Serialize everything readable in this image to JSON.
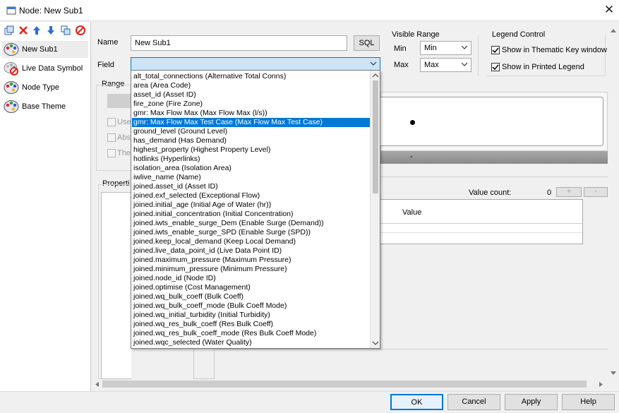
{
  "window": {
    "title": "Node: New Sub1"
  },
  "left_pane": {
    "items": [
      {
        "label": "New Sub1"
      },
      {
        "label": "Live Data Symbol"
      },
      {
        "label": "Node Type"
      },
      {
        "label": "Base Theme"
      }
    ]
  },
  "form": {
    "name_label": "Name",
    "name_value": "New Sub1",
    "sql_label": "SQL",
    "field_label": "Field",
    "range_label": "Range",
    "use_label": "Use",
    "abs_label": "Abs",
    "the_label": "Ther",
    "properties_label": "Properti"
  },
  "visible_range": {
    "title": "Visible Range",
    "min_label": "Min",
    "min_value": "Min",
    "max_label": "Max",
    "max_value": "Max"
  },
  "legend_control": {
    "title": "Legend Control",
    "thematic_label": "Show in Thematic Key window",
    "printed_label": "Show in Printed Legend"
  },
  "values_panel": {
    "preview_dash": "-",
    "value_count_label": "Value count:",
    "value_count": "0",
    "plus": "+",
    "minus": "-",
    "value_header": "Value"
  },
  "field_dropdown": {
    "items": [
      "alt_total_connections (Alternative Total Conns)",
      "area (Area Code)",
      "asset_id (Asset ID)",
      "fire_zone (Fire Zone)",
      "gmr: Max Flow Max (Max Flow Max (l/s))",
      "gmr: Max Flow Max Test Case (Max Flow Max Test Case)",
      "ground_level (Ground Level)",
      "has_demand (Has Demand)",
      "highest_property (Highest Property Level)",
      "hotlinks (Hyperlinks)",
      "isolation_area (Isolation Area)",
      "iwlive_name (Name)",
      "joined.asset_id (Asset ID)",
      "joined.exf_selected (Exceptional Flow)",
      "joined.initial_age (Initial Age of Water (hr))",
      "joined.initial_concentration (Initial  Concentration)",
      "joined.iwts_enable_surge_Dem (Enable Surge (Demand))",
      "joined.iwts_enable_surge_SPD (Enable Surge (SPD))",
      "joined.keep_local_demand (Keep Local Demand)",
      "joined.live_data_point_id (Live Data Point ID)",
      "joined.maximum_pressure (Maximum Pressure)",
      "joined.minimum_pressure (Minimum Pressure)",
      "joined.node_id (Node ID)",
      "joined.optimise (Cost Management)",
      "joined.wq_bulk_coeff (Bulk Coeff)",
      "joined.wq_bulk_coeff_mode (Bulk Coeff Mode)",
      "joined.wq_initial_turbidity (Initial  Turbidity)",
      "joined.wq_res_bulk_coeff (Res Bulk Coeff)",
      "joined.wq_res_bulk_coeff_mode (Res Bulk Coeff Mode)",
      "joined.wqc_selected (Water Quality)"
    ],
    "selected_index": 5
  },
  "buttons": {
    "ok": "OK",
    "cancel": "Cancel",
    "apply": "Apply",
    "help": "Help"
  },
  "colors": {
    "accent": "#0078d7",
    "dialog_bg": "#f0f0f0"
  }
}
